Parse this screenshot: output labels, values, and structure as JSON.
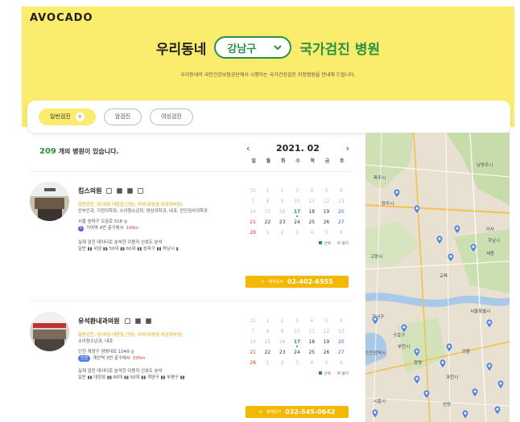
{
  "brand": "AVOCADO",
  "hero": {
    "title_left": "우리동네",
    "district": "강남구",
    "title_right": "국가검진 병원",
    "subtitle": "우리동네의 국민건강보험공단에서 시행하는 국가건강검진 지정병원을 안내해 드립니다."
  },
  "filters": [
    {
      "label": "일반검진",
      "selected": true,
      "remove": "×"
    },
    {
      "label": "암검진",
      "selected": false
    },
    {
      "label": "여성검진",
      "selected": false
    }
  ],
  "count": {
    "number": "209",
    "label": "개의 병원이 있습니다."
  },
  "calendar": {
    "month": "2021. 02",
    "prev": "‹",
    "next": "›",
    "weekdays": [
      "일",
      "월",
      "화",
      "수",
      "목",
      "금",
      "토"
    ]
  },
  "hospitals": [
    {
      "name": "킴스의원",
      "checkups": "일반검진, 암(위암,대장암,간암), 여성(유방암,자궁경부암)",
      "departments": "산부인과, 가정의학과, 소아청소년과, 영상의학과, 내과, 진단검사의학과",
      "address": "서울 송파구 오금로 518 ◎",
      "station_badge": "5",
      "station": "거여역 4번 출구에서",
      "distance": "143m",
      "note": "실제 검진 데이터로 분석한 이용자 선호도 분석",
      "prefs": "일반 ▮▮ 위암 ▮▮ 50대 ▮▮ 60대 ▮▮ 송파구 ▮▮ 하남시 ▮",
      "phone_label": "예약문의",
      "phone": "02-402-6555"
    },
    {
      "name": "유석환내과의원",
      "checkups": "일반검진, 암(위암,대장암,간암), 여성(유방암,자궁경부암)",
      "departments": "소아청소년과, 내과",
      "address": "인천 계양구 경명대로 1049 ◎",
      "station_badge": "인천",
      "station": "계산역 3번 출구에서",
      "distance": "335m",
      "note": "실제 검진 데이터로 분석한 이용자 선호도 분석",
      "prefs": "일반 ▮▮ 대장암 ▮▮ 60대 ▮▮ 50대 ▮▮ 계양구 ▮▮ 부평구 ▮▮",
      "phone_label": "예약문의",
      "phone": "032-545-0642"
    }
  ],
  "mini_calendar": {
    "rows": [
      [
        "31",
        "1",
        "2",
        "3",
        "4",
        "5",
        "6"
      ],
      [
        "7",
        "8",
        "9",
        "10",
        "11",
        "12",
        "13"
      ],
      [
        "14",
        "15",
        "16",
        "17",
        "18",
        "19",
        "20"
      ],
      [
        "21",
        "22",
        "23",
        "24",
        "25",
        "26",
        "27"
      ],
      [
        "28",
        "1",
        "2",
        "3",
        "4",
        "5",
        "6"
      ]
    ],
    "legend_open": "선택",
    "legend_closed": "불가"
  },
  "map": {
    "labels": [
      "파주시",
      "남양주시",
      "양주시",
      "미사",
      "고양시",
      "교육",
      "세종",
      "강서구",
      "서울특별시",
      "구로구",
      "부천시",
      "인천광역시",
      "시흥시",
      "과천시",
      "의왕",
      "하남시",
      "광명",
      "안양"
    ]
  }
}
